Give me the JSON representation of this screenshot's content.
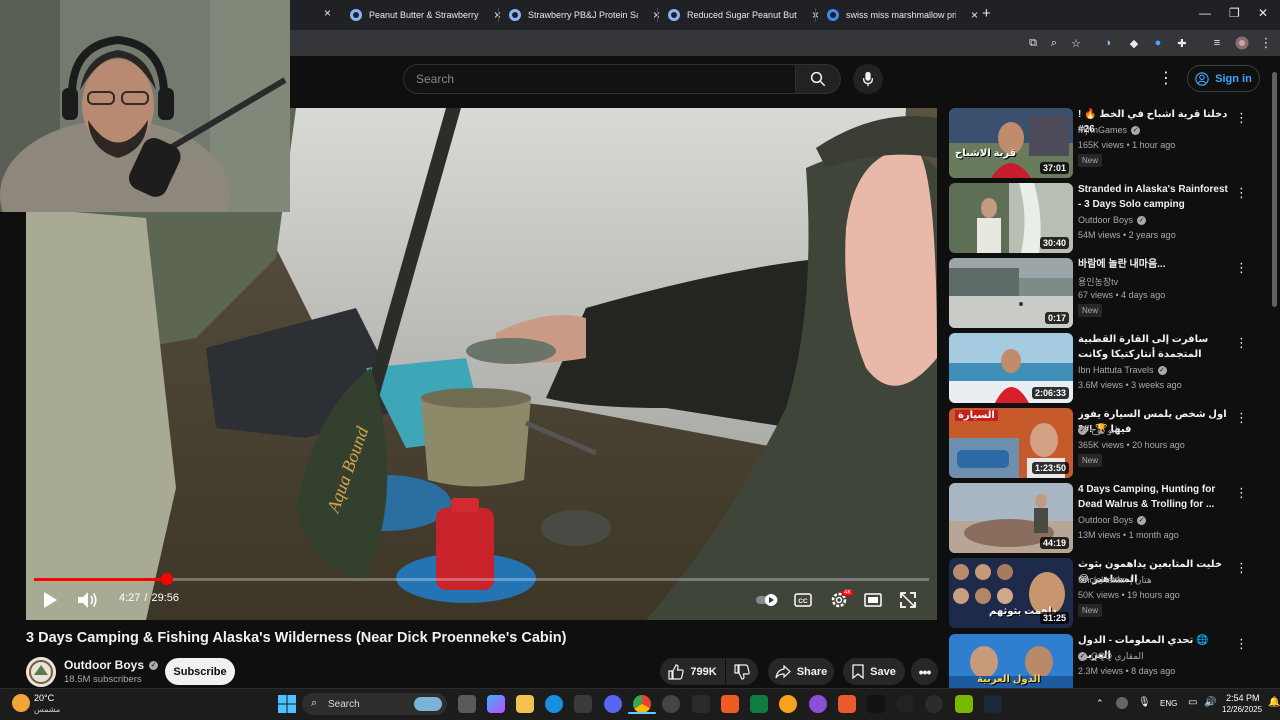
{
  "browser": {
    "tabs": [
      {
        "label": "Peanut Butter & Strawberry Sp"
      },
      {
        "label": "Strawberry PB&J Protein Sandw"
      },
      {
        "label": "Reduced Sugar Peanut Butter &"
      },
      {
        "label": "swiss miss marshmallow price -"
      }
    ],
    "new_tab": "+",
    "close_glyph": "×"
  },
  "header": {
    "search_placeholder": "Search",
    "more_glyph": "⋮",
    "signin_label": "Sign in"
  },
  "player": {
    "current_time": "4:27",
    "separator": "/",
    "duration": "29:56",
    "progress": 0.149,
    "hd_badge": "4K",
    "paddle_text": "Aqua Bound"
  },
  "video": {
    "title": "3 Days Camping & Fishing Alaska's Wilderness (Near Dick Proenneke's Cabin)",
    "channel": "Outdoor Boys",
    "subscribers": "18.5M subscribers",
    "subscribe_label": "Subscribe",
    "likes": "799K",
    "share_label": "Share",
    "save_label": "Save"
  },
  "recommendations": [
    {
      "title": "دخلنا قرية اشباح في الخط 🔥 ! 26#",
      "channel": "MjrmGames",
      "verified": true,
      "meta": "165K views • 1 hour ago",
      "badge": "New",
      "duration": "37:01",
      "thumb_text": "قرية الاشباح"
    },
    {
      "title": "Stranded in Alaska's Rainforest - 3 Days Solo camping",
      "channel": "Outdoor Boys",
      "verified": true,
      "meta": "54M views • 2 years ago",
      "badge": "",
      "duration": "30:40",
      "thumb_text": ""
    },
    {
      "title": "바람에 놀란 내마음...",
      "channel": "용인농장tv",
      "verified": false,
      "meta": "67 views • 4 days ago",
      "badge": "New",
      "duration": "0:17",
      "thumb_text": ""
    },
    {
      "title": "سافرت إلى القارة القطبية المتجمدة أنتاركتيكا وكانت التجربة كاملة AQ",
      "channel": "Ibn Hattuta Travels",
      "verified": true,
      "meta": "3.6M views • 3 weeks ago",
      "badge": "",
      "duration": "2:06:33",
      "thumb_text": ""
    },
    {
      "title": "اول شخص يلمس السيارة يفوز فيها 🏆 !#2",
      "channel": "ابو دوح",
      "verified": true,
      "meta": "365K views • 20 hours ago",
      "badge": "New",
      "duration": "1:23:50",
      "thumb_text": "السيارة"
    },
    {
      "title": "4 Days Camping, Hunting for Dead Walrus & Trolling for ...",
      "channel": "Outdoor Boys",
      "verified": true,
      "meta": "13M views • 1 month ago",
      "badge": "",
      "duration": "44:19",
      "thumb_text": ""
    },
    {
      "title": "خليت المتابعين يداهمون بثوث المشاهير 😂",
      "channel": "UncleHattan | هتان",
      "verified": false,
      "meta": "50K views • 19 hours ago",
      "badge": "New",
      "duration": "31:25",
      "thumb_text": "داهمت بثوثهم"
    },
    {
      "title": "🌐 تحدي المعلومات - الدول العربية",
      "channel": "QQQ المقاري",
      "verified": true,
      "meta": "2.3M views • 8 days ago",
      "badge": "",
      "duration": "",
      "thumb_text": "الدول العربية"
    }
  ],
  "taskbar": {
    "weather_temp": "20°C",
    "weather_desc": "مشمس",
    "search_label": "Search",
    "lang": "ENG",
    "time": "2:54 PM",
    "date": "12/26/2025"
  },
  "colors": {
    "accent_red": "#ff0000",
    "link_blue": "#3ea6ff",
    "background": "#0f0f0f"
  }
}
